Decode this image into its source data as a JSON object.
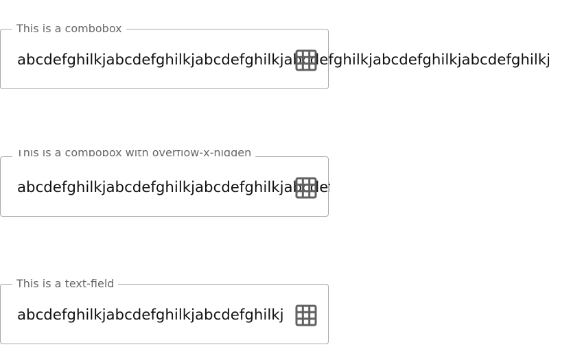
{
  "fields": [
    {
      "label": "This is a combobox",
      "value": "abcdefghilkjabcdefghilkjabcdefghilkjabcdefghilkjabcdefghilkjabcdefghilkj",
      "icon": "grid-icon"
    },
    {
      "label": "This is a combobox with overflow-x-hidden",
      "value": "abcdefghilkjabcdefghilkjabcdefghilkjabcdefghilkjabcdefghilkjabcdefghilkj",
      "icon": "grid-icon"
    },
    {
      "label": "This is a text-field",
      "value": "abcdefghilkjabcdefghilkjabcdefghilkj",
      "icon": "grid-icon"
    }
  ],
  "colors": {
    "border": "#a7a7a7",
    "label": "#666666",
    "text": "#111111",
    "icon": "#616161"
  }
}
